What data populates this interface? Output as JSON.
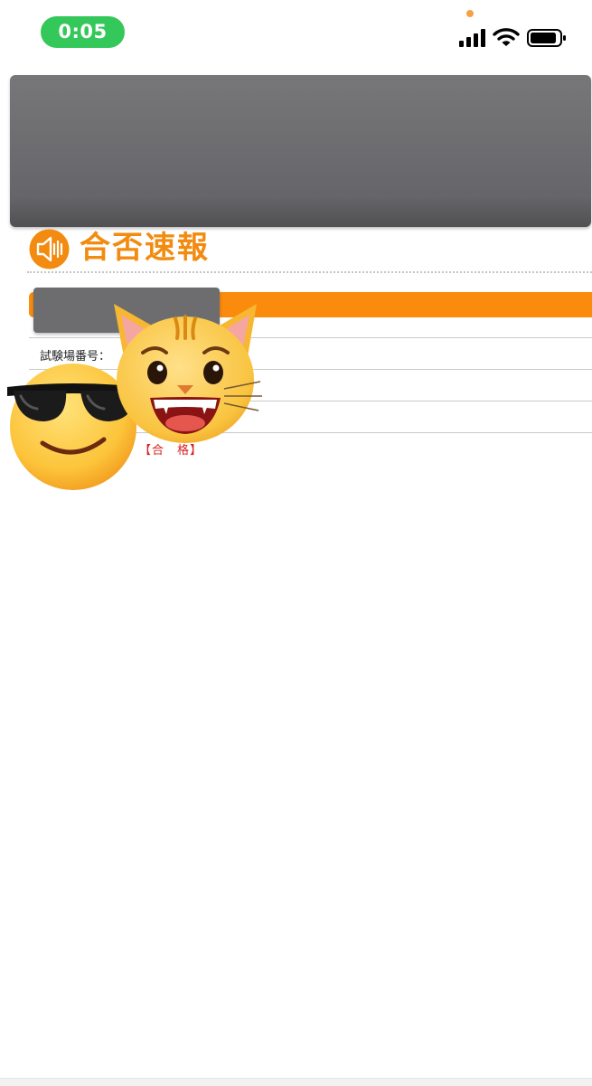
{
  "status_bar": {
    "time": "0:05",
    "accent_color": "#34c759",
    "icons": [
      "signal-icon",
      "wifi-icon",
      "battery-icon"
    ]
  },
  "heading": {
    "title": "合否速報",
    "icon": "speaker-icon",
    "color": "#f28b0f"
  },
  "result_table": {
    "exam_site_label": "試験場番号：",
    "result_value": "【合　格】",
    "result_color": "#d81f1f"
  },
  "overlays": [
    "smiling-face-with-sunglasses-emoji",
    "grinning-cat-emoji"
  ],
  "bar_color": "#fb8b0d"
}
